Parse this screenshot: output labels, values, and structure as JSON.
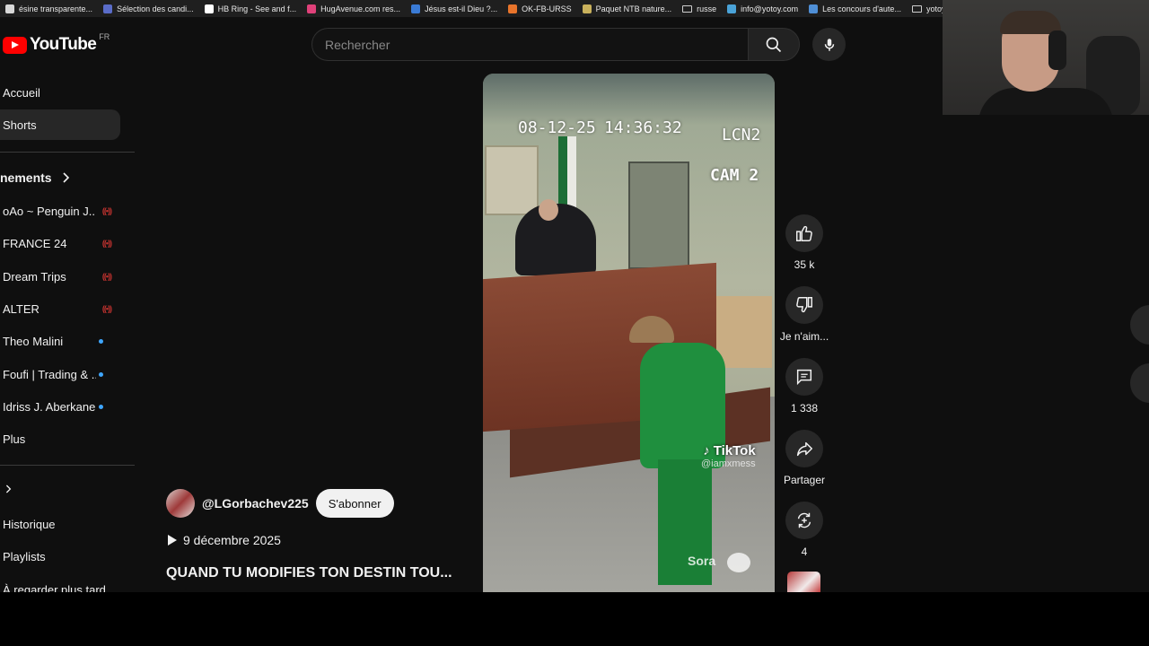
{
  "bookmarks": [
    {
      "label": "ésine transparente...",
      "color": "#d8d8d8"
    },
    {
      "label": "Sélection des candi...",
      "color": "#5a6cc8"
    },
    {
      "label": "HB Ring - See and f...",
      "color": "#ffffff"
    },
    {
      "label": "HugAvenue.com res...",
      "color": "#e0417a"
    },
    {
      "label": "Jésus est-il Dieu ?...",
      "color": "#3a7bd5"
    },
    {
      "label": "OK-FB-URSS",
      "color": "#e8742b"
    },
    {
      "label": "Paquet NTB nature...",
      "color": "#c9b15c"
    },
    {
      "label": "russe",
      "color": "folder"
    },
    {
      "label": "info@yotoy.com",
      "color": "#4aa3d8"
    },
    {
      "label": "Les concours d'aute...",
      "color": "#4f8fd6"
    },
    {
      "label": "yotoy",
      "color": "folder"
    }
  ],
  "masthead": {
    "logo_text": "YouTube",
    "country": "FR",
    "search_placeholder": "Rechercher"
  },
  "sidebar": {
    "nav": [
      {
        "label": "Accueil",
        "active": false
      },
      {
        "label": "Shorts",
        "active": true
      }
    ],
    "subscriptions_head": "nements",
    "subscriptions": [
      {
        "name": "oAo ~ Penguin J...",
        "status": "live"
      },
      {
        "name": "FRANCE 24",
        "status": "live"
      },
      {
        "name": "Dream Trips",
        "status": "live"
      },
      {
        "name": "ALTER",
        "status": "live"
      },
      {
        "name": "Theo Malini",
        "status": "new"
      },
      {
        "name": "Foufi | Trading & ...",
        "status": "new"
      },
      {
        "name": "Idriss J. Aberkane",
        "status": "new"
      },
      {
        "name": "Plus",
        "status": "none"
      }
    ],
    "you_head": ">",
    "you_items": [
      "Historique",
      "Playlists",
      "À regarder plus tard"
    ]
  },
  "video": {
    "overlay_date": "08-12-25",
    "overlay_time": "14:36:32",
    "overlay_channel": "LCN2",
    "overlay_cam": "CAM 2",
    "tiktok_brand": "TikTok",
    "tiktok_handle": "@iamxmess",
    "sora_label": "Sora"
  },
  "actions": {
    "likes": "35 k",
    "dislike_label": "Je n'aim...",
    "comments": "1 338",
    "share_label": "Partager",
    "remix_count": "4"
  },
  "channel": {
    "handle": "@LGorbachev225",
    "subscribe_label": "S'abonner",
    "date": "9 décembre 2025",
    "title": "QUAND TU MODIFIES TON DESTIN TOU..."
  },
  "colors": {
    "background": "#0f0f0f",
    "brand_red": "#ff0000",
    "live_red": "#c0322f",
    "new_dot": "#3ea6ff"
  }
}
